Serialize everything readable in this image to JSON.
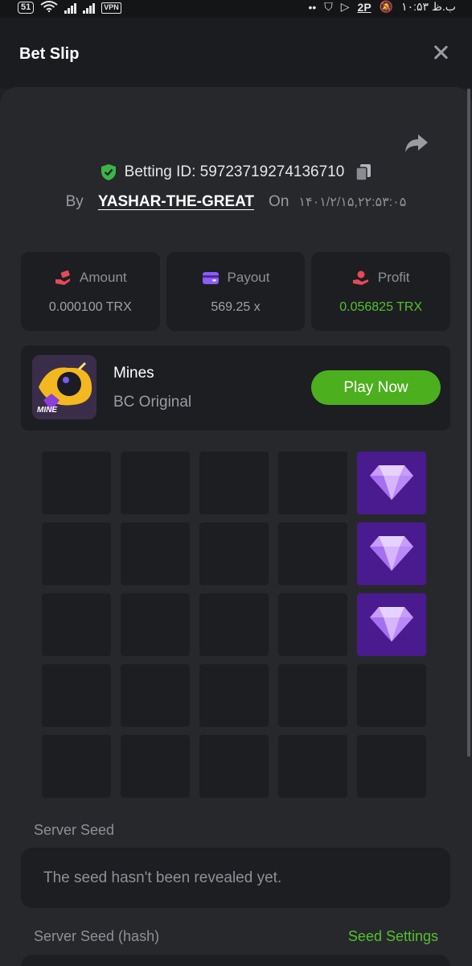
{
  "statusbar": {
    "battery": "51",
    "network": "4G",
    "vpn": "VPN",
    "sim_label": "2P",
    "time": "۱۰:۵۳ ب.ظ"
  },
  "header": {
    "title": "Bet Slip"
  },
  "bet": {
    "id_label": "Betting ID: 59723719274136710",
    "by_label": "By",
    "user": "YASHAR-THE-GREAT",
    "on_label": "On",
    "date": "۱۴۰۱/۲/۱۵,۲۲:۵۳:۰۵"
  },
  "stats": [
    {
      "label": "Amount",
      "value": "0.000100 TRX",
      "icon": "money-hand-icon"
    },
    {
      "label": "Payout",
      "value": "569.25 x",
      "icon": "wallet-icon"
    },
    {
      "label": "Profit",
      "value": "0.056825 TRX",
      "icon": "profit-hand-icon"
    }
  ],
  "game": {
    "name": "Mines",
    "provider": "BC Original",
    "thumb_label": "MINE",
    "play_label": "Play Now"
  },
  "board": {
    "rows": 5,
    "cols": 5,
    "gems": [
      4,
      9,
      14
    ]
  },
  "seeds": {
    "server_seed_label": "Server Seed",
    "server_seed_value": "The seed hasn't been revealed yet.",
    "hash_label": "Server Seed (hash)",
    "settings_label": "Seed Settings"
  },
  "colors": {
    "accent_green": "#4caf1e",
    "gem_bg": "#4a1a8f",
    "panel": "#27282c",
    "card": "#1d1e21"
  }
}
